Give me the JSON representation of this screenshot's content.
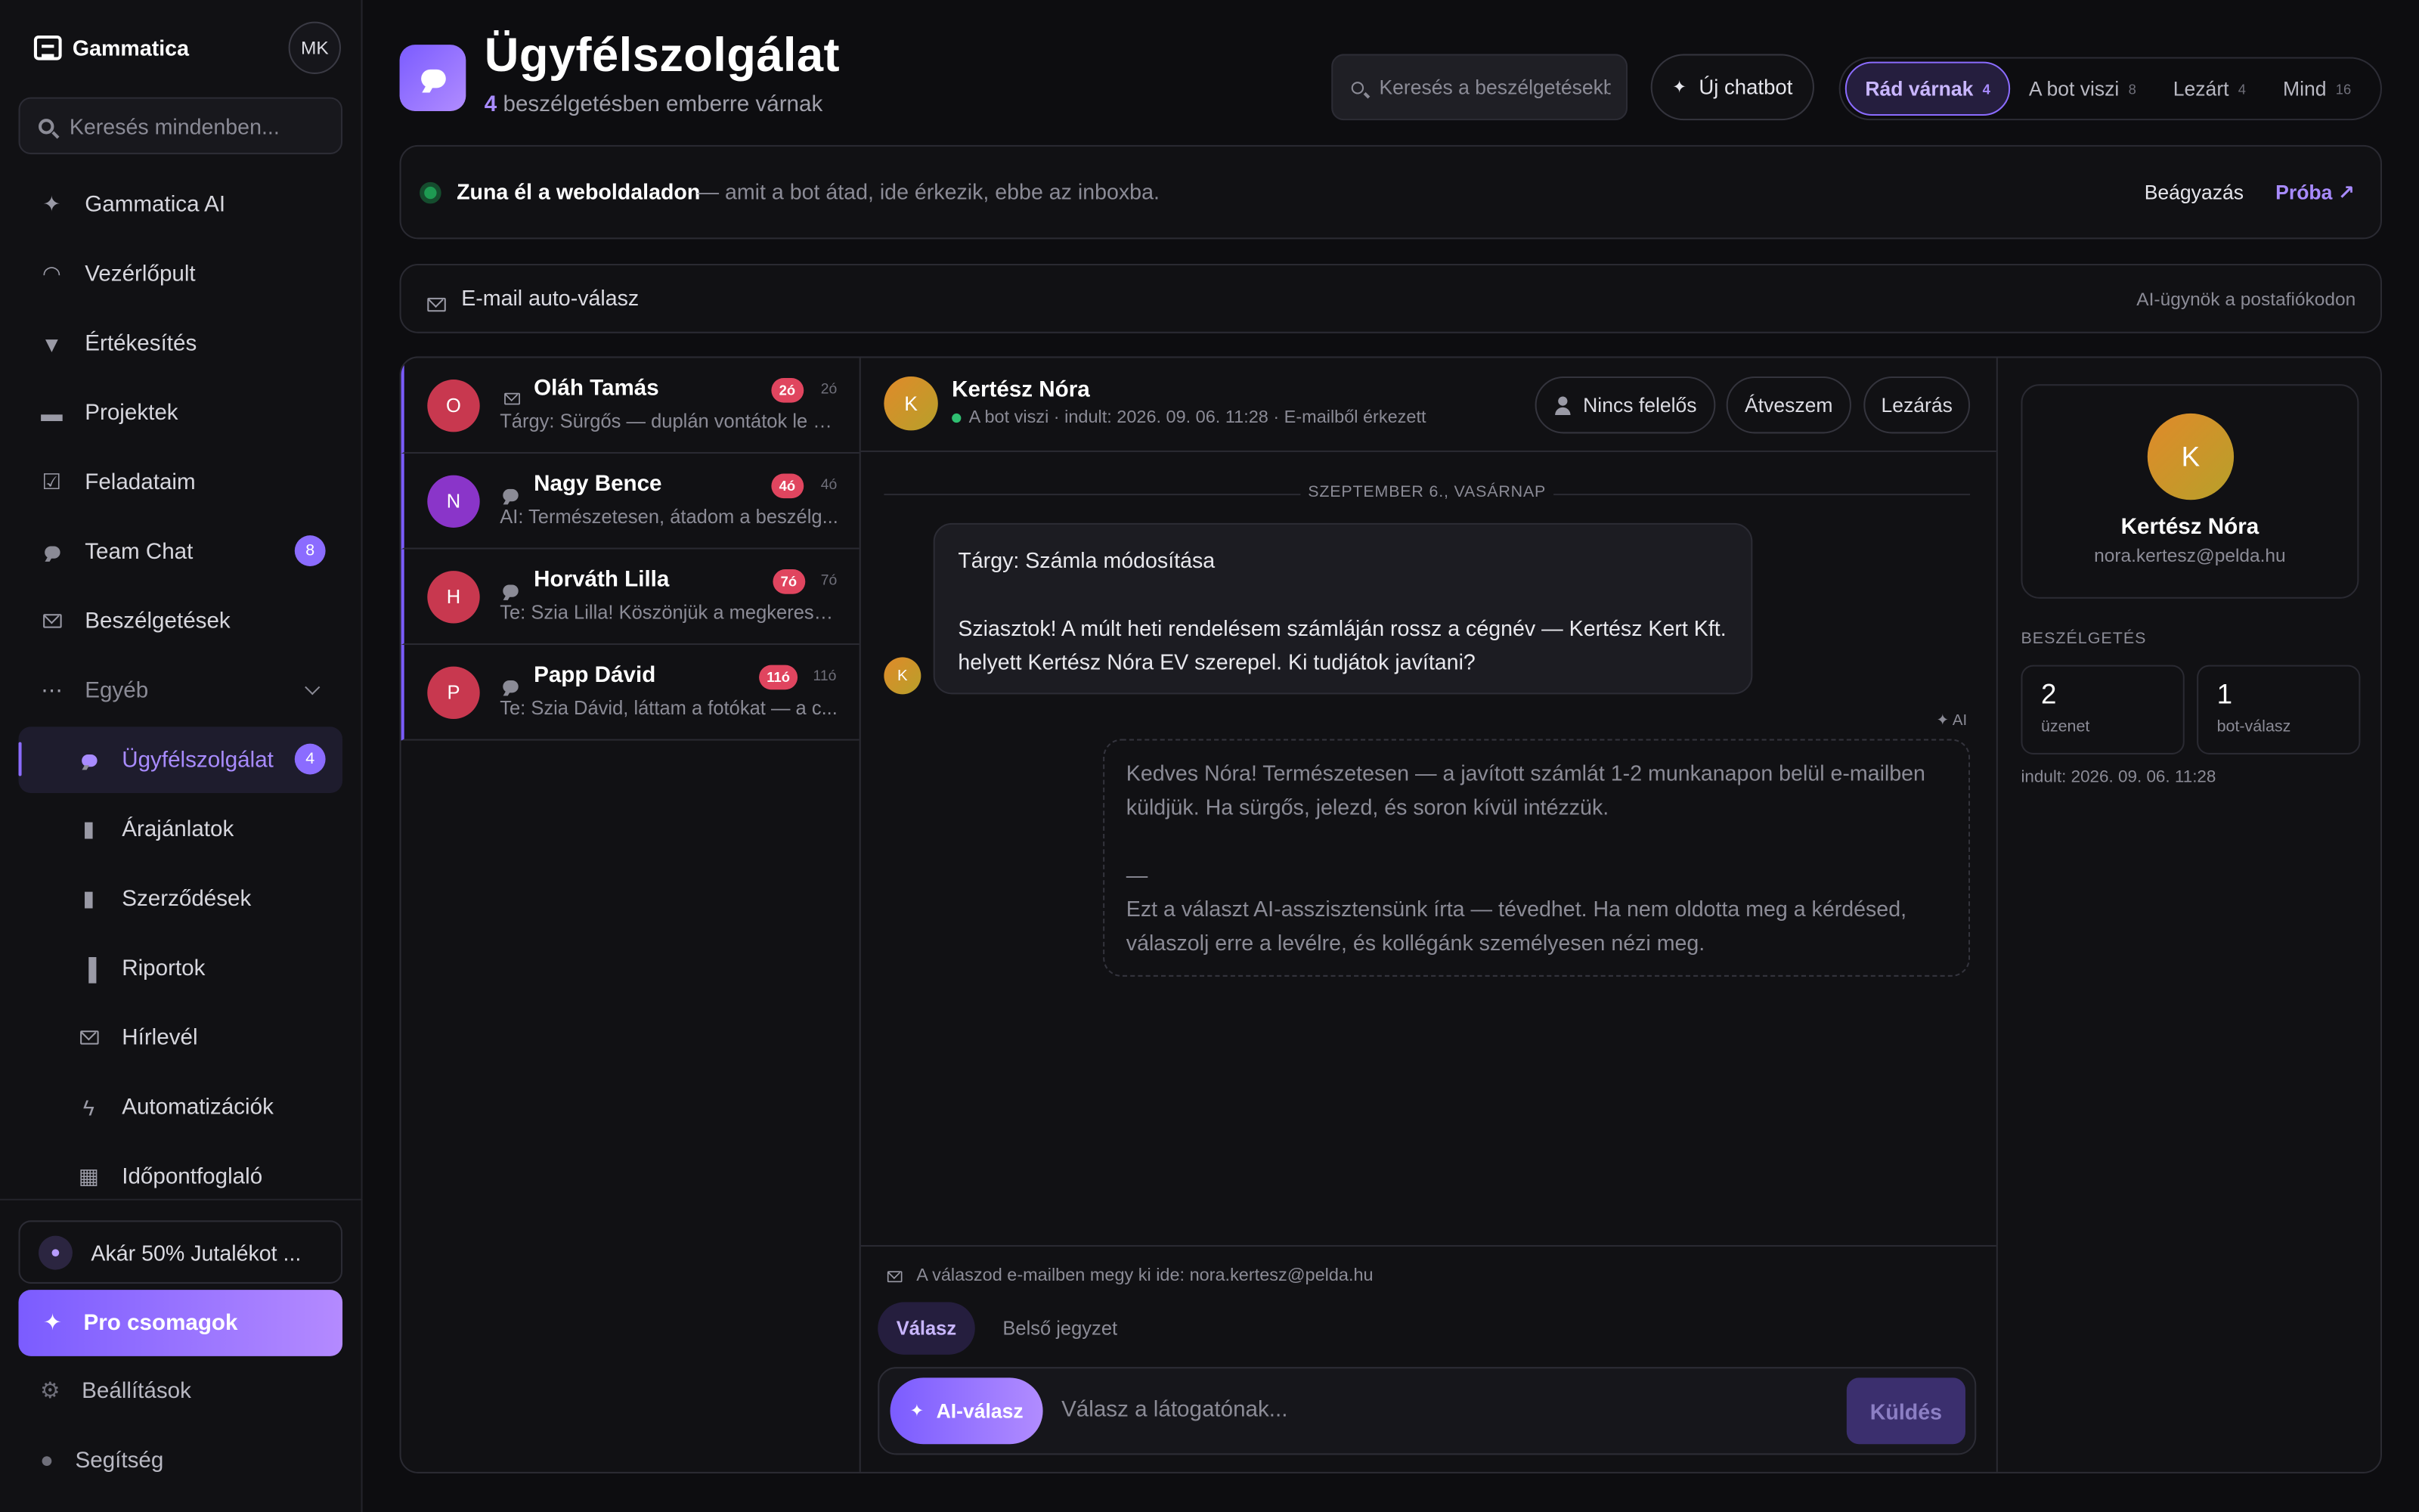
{
  "brand": {
    "name": "Gammatica",
    "avatar_initials": "MK"
  },
  "sidebar": {
    "search_placeholder": "Keresés mindenben...",
    "items": [
      {
        "label": "Gammatica AI",
        "icon": "sparkle-icon"
      },
      {
        "label": "Vezérlőpult",
        "icon": "gauge-icon"
      },
      {
        "label": "Értékesítés",
        "icon": "filter-icon"
      },
      {
        "label": "Projektek",
        "icon": "folder-icon"
      },
      {
        "label": "Feladataim",
        "icon": "checkbox-icon"
      },
      {
        "label": "Team Chat",
        "icon": "chat-icon",
        "badge": "8"
      },
      {
        "label": "Beszélgetések",
        "icon": "mail-icon"
      },
      {
        "label": "Egyéb",
        "icon": "more-icon"
      }
    ],
    "sub_items": [
      {
        "label": "Ügyfélszolgálat",
        "icon": "chat-icon",
        "badge": "4",
        "active": true
      },
      {
        "label": "Árajánlatok",
        "icon": "document-icon"
      },
      {
        "label": "Szerződések",
        "icon": "document-icon"
      },
      {
        "label": "Riportok",
        "icon": "bar-chart-icon"
      },
      {
        "label": "Hírlevél",
        "icon": "mail-icon"
      },
      {
        "label": "Automatizációk",
        "icon": "bolt-icon"
      },
      {
        "label": "Időpontfoglaló",
        "icon": "calendar-icon"
      }
    ],
    "promo": "Akár 50% Jutalékot ...",
    "pro_button": "Pro csomagok",
    "settings": "Beállítások",
    "help": "Segítség"
  },
  "header": {
    "title": "Ügyfélszolgálat",
    "subtitle_count": "4",
    "subtitle_text": " beszélgetésben emberre várnak",
    "search_placeholder": "Keresés a beszélgetésekben",
    "new_chatbot": "Új chatbot",
    "filters": [
      {
        "label": "Rád várnak",
        "count": "4",
        "active": true
      },
      {
        "label": "A bot viszi",
        "count": "8"
      },
      {
        "label": "Lezárt",
        "count": "4"
      },
      {
        "label": "Mind",
        "count": "16"
      }
    ]
  },
  "banner_live": {
    "title": "Zuna él a weboldaladon",
    "subtitle": "— amit a bot átad, ide érkezik, ebbe az inboxba.",
    "embed": "Beágyazás",
    "try": "Próba ↗"
  },
  "banner_email": {
    "title": "E-mail auto-válasz",
    "right": "AI-ügynök a postafiókodon"
  },
  "conversations": [
    {
      "initial": "O",
      "name": "Oláh Tamás",
      "channel": "mail",
      "badge": "2ó",
      "time": "2ó",
      "preview": "Tárgy: Sürgős — duplán vontátok le a...",
      "color": "#c8384f"
    },
    {
      "initial": "N",
      "name": "Nagy Bence",
      "channel": "chat",
      "badge": "4ó",
      "time": "4ó",
      "preview": "AI: Természetesen, átadom a beszélg...",
      "color": "#8a35c9"
    },
    {
      "initial": "H",
      "name": "Horváth Lilla",
      "channel": "chat",
      "badge": "7ó",
      "time": "7ó",
      "preview": "Te: Szia Lilla! Köszönjük a megkeresé...",
      "color": "#c8384f"
    },
    {
      "initial": "P",
      "name": "Papp Dávid",
      "channel": "chat",
      "badge": "11ó",
      "time": "11ó",
      "preview": "Te: Szia Dávid, láttam a fotókat — a c...",
      "color": "#c8384f"
    }
  ],
  "chat": {
    "initial": "K",
    "name": "Kertész Nóra",
    "meta": "A bot viszi · indult: 2026. 09. 06. 11:28 · E-mailből érkezett",
    "assignee": "Nincs felelős",
    "take_over": "Átveszem",
    "close": "Lezárás",
    "date_separator": "SZEPTEMBER 6., VASÁRNAP",
    "incoming_subject": "Tárgy: Számla módosítása",
    "incoming_body": "Sziasztok! A múlt heti rendelésem számláján rossz a cégnév — Kertész Kert Kft. helyett Kertész Nóra EV szerepel. Ki tudjátok javítani?",
    "ai_tag": "✦ AI",
    "ai_reply": "Kedves Nóra! Természetesen — a javított számlát 1-2 munkanapon belül e-mailben küldjük. Ha sürgős, jelezd, és soron kívül intézzük.",
    "ai_dash": "—",
    "ai_disclaimer": "Ezt a választ AI-asszisztensünk írta — tévedhet. Ha nem oldotta meg a kérdésed, válaszolj erre a levélre, és kollégánk személyesen nézi meg.",
    "reply_note": "A válaszod e-mailben megy ki ide: nora.kertesz@pelda.hu",
    "tab_reply": "Válasz",
    "tab_note": "Belső jegyzet",
    "ai_button": "AI-válasz",
    "input_placeholder": "Válasz a látogatónak...",
    "send": "Küldés"
  },
  "contact": {
    "initial": "K",
    "name": "Kertész Nóra",
    "email": "nora.kertesz@pelda.hu",
    "section": "BESZÉLGETÉS",
    "messages_value": "2",
    "messages_label": "üzenet",
    "bot_value": "1",
    "bot_label": "bot-válasz",
    "started": "indult: 2026. 09. 06. 11:28"
  },
  "colors": {
    "accent": "#8b6cff",
    "badge_red": "#e0455f",
    "live_green": "#2fbf71"
  }
}
